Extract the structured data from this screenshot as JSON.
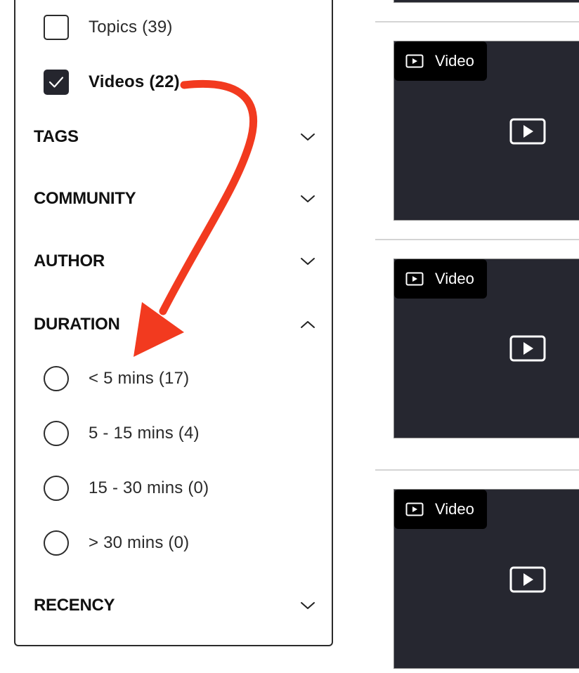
{
  "filters": {
    "content_type": [
      {
        "label": "Topics (39)",
        "checked": false
      },
      {
        "label": "Videos (22)",
        "checked": true
      }
    ],
    "sections": {
      "tags": {
        "title": "TAGS",
        "expanded": false
      },
      "community": {
        "title": "COMMUNITY",
        "expanded": false
      },
      "author": {
        "title": "AUTHOR",
        "expanded": false
      },
      "duration": {
        "title": "DURATION",
        "expanded": true,
        "options": [
          {
            "label": "< 5 mins (17)"
          },
          {
            "label": "5 - 15 mins (4)"
          },
          {
            "label": "15 - 30 mins (0)"
          },
          {
            "label": "> 30 mins (0)"
          }
        ]
      },
      "recency": {
        "title": "RECENCY",
        "expanded": false
      }
    }
  },
  "results": {
    "cards": [
      {
        "badge": "Video"
      },
      {
        "badge": "Video"
      },
      {
        "badge": "Video"
      }
    ]
  },
  "annotation": {
    "color": "#f23a1f"
  },
  "colors": {
    "card_bg": "#262730",
    "checkbox_checked": "#25262e"
  }
}
